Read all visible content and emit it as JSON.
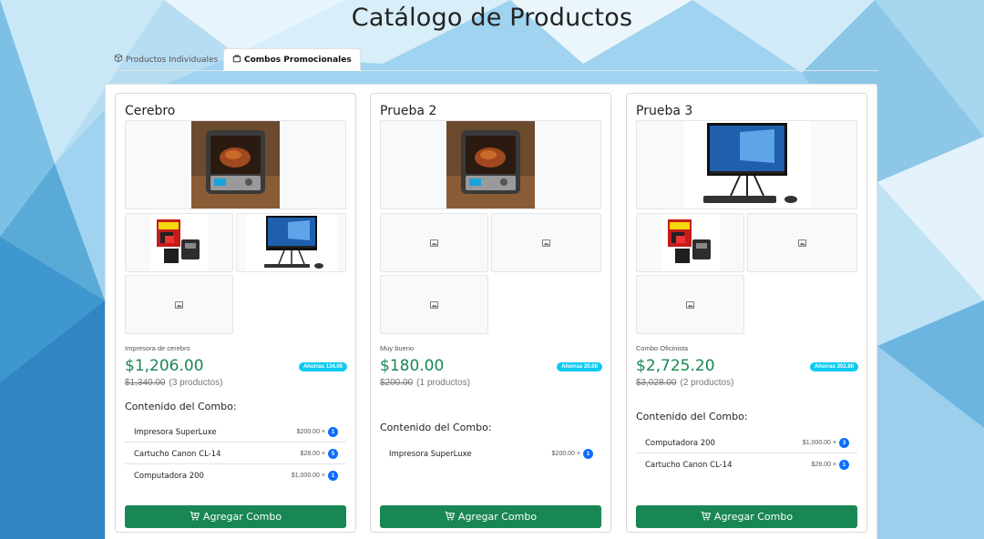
{
  "page": {
    "title": "Catálogo de Productos"
  },
  "tabs": [
    {
      "label": "Productos Individuales",
      "icon": "box-icon",
      "active": false
    },
    {
      "label": "Combos Promocionales",
      "icon": "bag-icon",
      "active": true
    }
  ],
  "combos": [
    {
      "name": "Cerebro",
      "description": "Impresora de cerebro",
      "price": "$1,206.00",
      "savings": "Ahorras 134.00",
      "original_price": "$1,340.00",
      "product_count": "(3 productos)",
      "contents_title": "Contenido del Combo:",
      "items": [
        {
          "name": "Impresora SuperLuxe",
          "price": "$200.00 ×",
          "qty": "1"
        },
        {
          "name": "Cartucho Canon CL-14",
          "price": "$28.00 ×",
          "qty": "5"
        },
        {
          "name": "Computadora 200",
          "price": "$1,000.00 ×",
          "qty": "1"
        }
      ],
      "button": "Agregar Combo"
    },
    {
      "name": "Prueba 2",
      "description": "Muy bueno",
      "price": "$180.00",
      "savings": "Ahorras 20.00",
      "original_price": "$200.00",
      "product_count": "(1 productos)",
      "contents_title": "Contenido del Combo:",
      "items": [
        {
          "name": "Impresora SuperLuxe",
          "price": "$200.00 ×",
          "qty": "1"
        }
      ],
      "button": "Agregar Combo"
    },
    {
      "name": "Prueba 3",
      "description": "Combo Oficinista",
      "price": "$2,725.20",
      "savings": "Ahorras 302.80",
      "original_price": "$3,028.00",
      "product_count": "(2 productos)",
      "contents_title": "Contenido del Combo:",
      "items": [
        {
          "name": "Computadora 200",
          "price": "$1,000.00 ×",
          "qty": "3"
        },
        {
          "name": "Cartucho Canon CL-14",
          "price": "$28.00 ×",
          "qty": "1"
        }
      ],
      "button": "Agregar Combo"
    }
  ],
  "colors": {
    "accent_green": "#198754",
    "savings_badge": "#0dcaf0",
    "qty_badge": "#0d6efd"
  }
}
